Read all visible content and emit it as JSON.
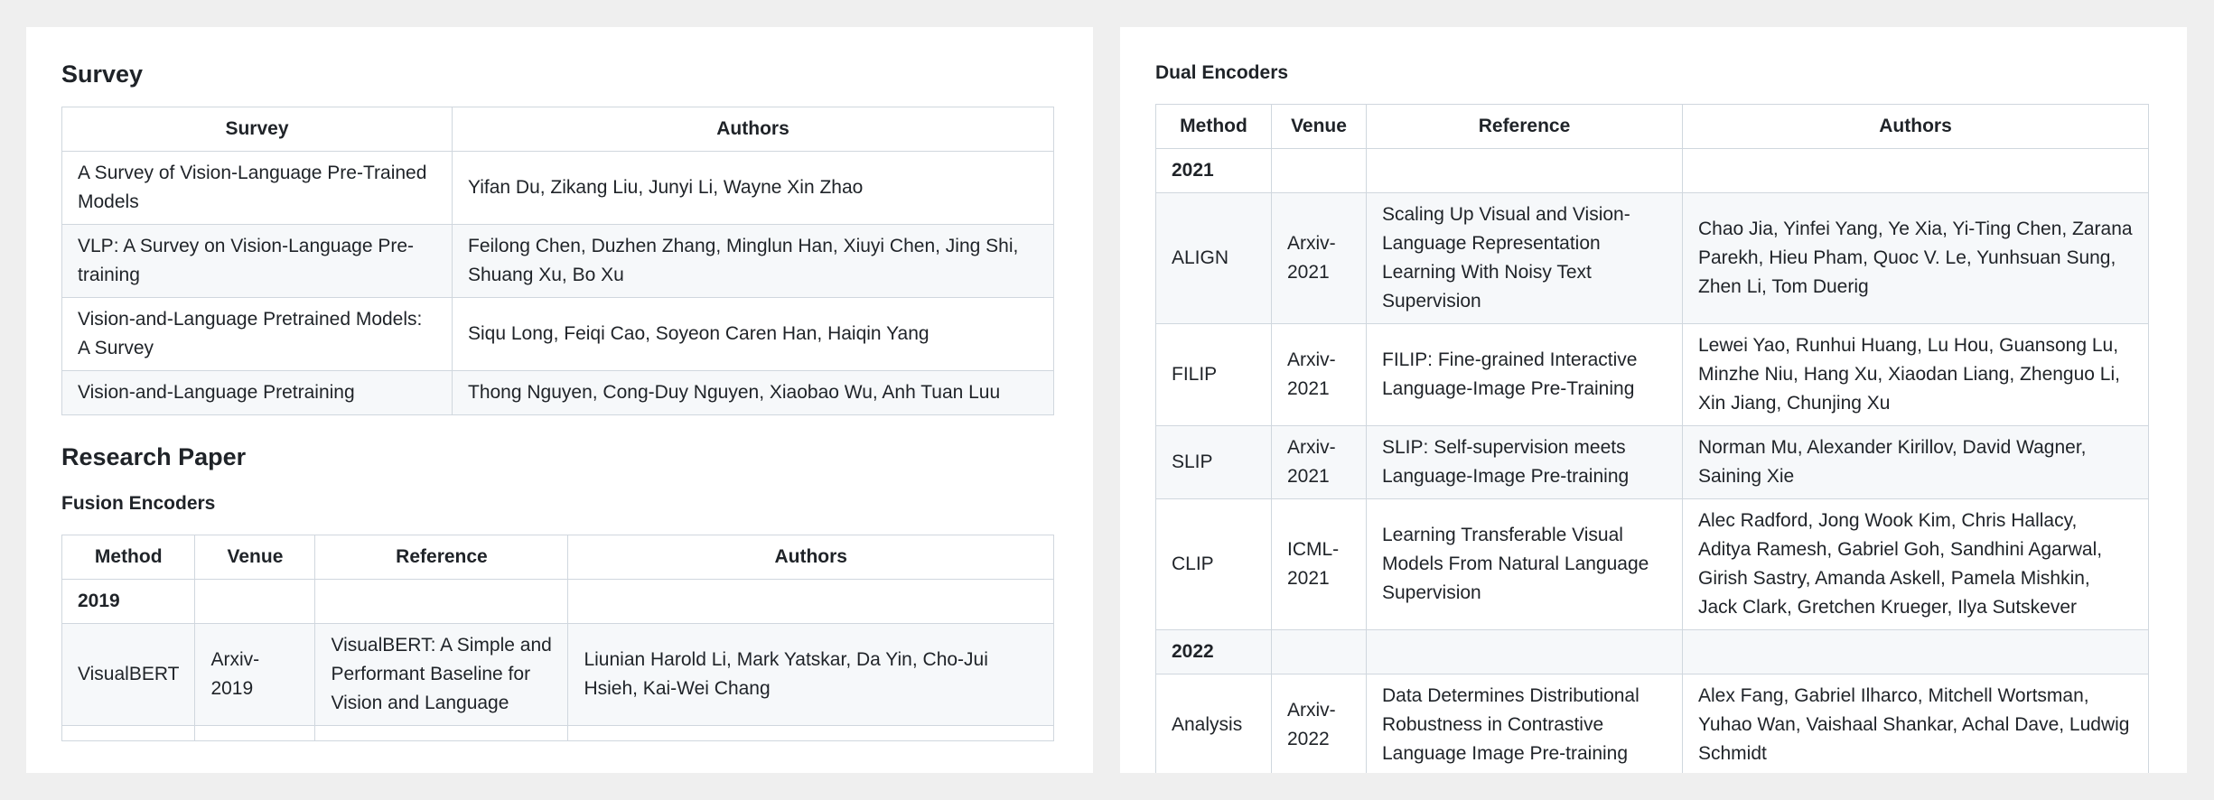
{
  "left": {
    "survey_heading": "Survey",
    "survey_headers": [
      "Survey",
      "Authors"
    ],
    "survey_rows": [
      [
        "A Survey of Vision-Language Pre-Trained Models",
        "Yifan Du, Zikang Liu, Junyi Li, Wayne Xin Zhao"
      ],
      [
        "VLP: A Survey on Vision-Language Pre-training",
        "Feilong Chen, Duzhen Zhang, Minglun Han, Xiuyi Chen, Jing Shi, Shuang Xu, Bo Xu"
      ],
      [
        "Vision-and-Language Pretrained Models: A Survey",
        "Siqu Long, Feiqi Cao, Soyeon Caren Han, Haiqin Yang"
      ],
      [
        "Vision-and-Language Pretraining",
        "Thong Nguyen, Cong-Duy Nguyen, Xiaobao Wu, Anh Tuan Luu"
      ]
    ],
    "research_heading": "Research Paper",
    "fusion_heading": "Fusion Encoders",
    "fusion_headers": [
      "Method",
      "Venue",
      "Reference",
      "Authors"
    ],
    "fusion_rows": [
      [
        "2019",
        "",
        "",
        ""
      ],
      [
        "VisualBERT",
        "Arxiv-2019",
        "VisualBERT: A Simple and Performant Baseline for Vision and Language",
        "Liunian Harold Li, Mark Yatskar, Da Yin, Cho-Jui Hsieh, Kai-Wei Chang"
      ],
      [
        "",
        "",
        "",
        ""
      ]
    ]
  },
  "right": {
    "dual_heading": "Dual Encoders",
    "dual_headers": [
      "Method",
      "Venue",
      "Reference",
      "Authors"
    ],
    "dual_rows": [
      [
        "2021",
        "",
        "",
        ""
      ],
      [
        "ALIGN",
        "Arxiv-2021",
        "Scaling Up Visual and Vision-Language Representation Learning With Noisy Text Supervision",
        "Chao Jia, Yinfei Yang, Ye Xia, Yi-Ting Chen, Zarana Parekh, Hieu Pham, Quoc V. Le, Yunhsuan Sung, Zhen Li, Tom Duerig"
      ],
      [
        "FILIP",
        "Arxiv-2021",
        "FILIP: Fine-grained Interactive Language-Image Pre-Training",
        "Lewei Yao, Runhui Huang, Lu Hou, Guansong Lu, Minzhe Niu, Hang Xu, Xiaodan Liang, Zhenguo Li, Xin Jiang, Chunjing Xu"
      ],
      [
        "SLIP",
        "Arxiv-2021",
        "SLIP: Self-supervision meets Language-Image Pre-training",
        "Norman Mu, Alexander Kirillov, David Wagner, Saining Xie"
      ],
      [
        "CLIP",
        "ICML-2021",
        "Learning Transferable Visual Models From Natural Language Supervision",
        "Alec Radford, Jong Wook Kim, Chris Hallacy, Aditya Ramesh, Gabriel Goh, Sandhini Agarwal, Girish Sastry, Amanda Askell, Pamela Mishkin, Jack Clark, Gretchen Krueger, Ilya Sutskever"
      ],
      [
        "2022",
        "",
        "",
        ""
      ],
      [
        "Analysis",
        "Arxiv-2022",
        "Data Determines Distributional Robustness in Contrastive Language Image Pre-training",
        "Alex Fang, Gabriel Ilharco, Mitchell Wortsman, Yuhao Wan, Vaishaal Shankar, Achal Dave, Ludwig Schmidt"
      ]
    ]
  }
}
